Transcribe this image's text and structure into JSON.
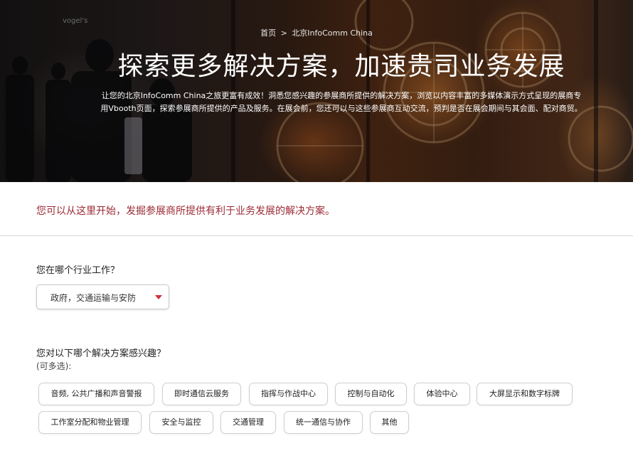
{
  "hero": {
    "breadcrumb": {
      "home": "首页",
      "separator": ">",
      "current": "北京InfoComm China"
    },
    "title": "探索更多解决方案，加速贵司业务发展",
    "description": "让您的北京InfoComm China之旅更富有成效！洞悉您感兴趣的参展商所提供的解决方案，浏览以内容丰富的多媒体演示方式呈现的展商专用Vbooth页面，探索参展商所提供的产品及服务。在展会前，您还可以与这些参展商互动交流，预判是否在展会期间与其会面、配对商贸。"
  },
  "intro": {
    "text": "您可以从这里开始，发掘参展商所提供有利于业务发展的解决方案。"
  },
  "industry": {
    "question": "您在哪个行业工作？",
    "selected": "政府，交通运输与安防",
    "caret_icon": "caret-down-icon"
  },
  "solutions": {
    "question": "您对以下哪个解决方案感兴趣？",
    "hint": "(可多选):",
    "options": [
      "音频, 公共广播和声音警报",
      "即时通信云服务",
      "指挥与作战中心",
      "控制与自动化",
      "体验中心",
      "大屏显示和数字标牌",
      "工作室分配和物业管理",
      "安全与监控",
      "交通管理",
      "统一通信与协作",
      "其他"
    ]
  },
  "colors": {
    "accent": "#d32e3c",
    "intro_text": "#9c2a36"
  }
}
